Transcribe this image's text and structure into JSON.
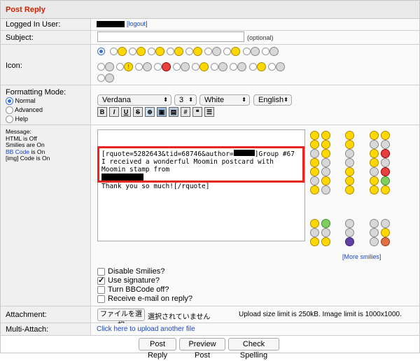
{
  "header": {
    "title": "Post Reply"
  },
  "logged_in": {
    "label": "Logged In User:",
    "logout": "[logout]"
  },
  "subject": {
    "label": "Subject:",
    "value": "",
    "optional": "(optional)"
  },
  "icon": {
    "label": "Icon:"
  },
  "formatting": {
    "label": "Formatting Mode:",
    "modes": [
      "Normal",
      "Advanced",
      "Help"
    ],
    "selected": "Normal",
    "font": "Verdana",
    "size": "3",
    "color": "White",
    "language": "English",
    "buttons": [
      "B",
      "I",
      "U",
      "S",
      "globe",
      "img",
      "img2",
      "#",
      "quote",
      "list"
    ]
  },
  "message": {
    "label": "Message:",
    "html_status": "HTML is Off",
    "smilies_status": "Smilies are On",
    "bbcode_link": "BB Code",
    "bbcode_suffix": " is On",
    "img_status": "[img] Code is On",
    "quote_line1_a": "[rquote=5282643&tid=68746&author=",
    "quote_line1_b": "]Group #67",
    "quote_line2": "I received a wonderful Moomin postcard with Moomin stamp from",
    "quote_line4": "Thank you so much![/rquote]",
    "more_smilies": "[More smilies]"
  },
  "options": [
    {
      "label": "Disable Smilies?",
      "checked": false
    },
    {
      "label": "Use signature?",
      "checked": true
    },
    {
      "label": "Turn BBCode off?",
      "checked": false
    },
    {
      "label": "Receive e-mail on reply?",
      "checked": false
    }
  ],
  "attachment": {
    "label": "Attachment:",
    "choose_button": "ファイルを選択",
    "no_file": "選択されていません",
    "limit_text": "Upload size limit is 250kB. Image limit is 1000x1000."
  },
  "multi_attach": {
    "label": "Multi-Attach:",
    "link": "Click here to upload another file"
  },
  "actions": {
    "post": "Post Reply",
    "preview": "Preview Post",
    "spell": "Check Spelling"
  }
}
